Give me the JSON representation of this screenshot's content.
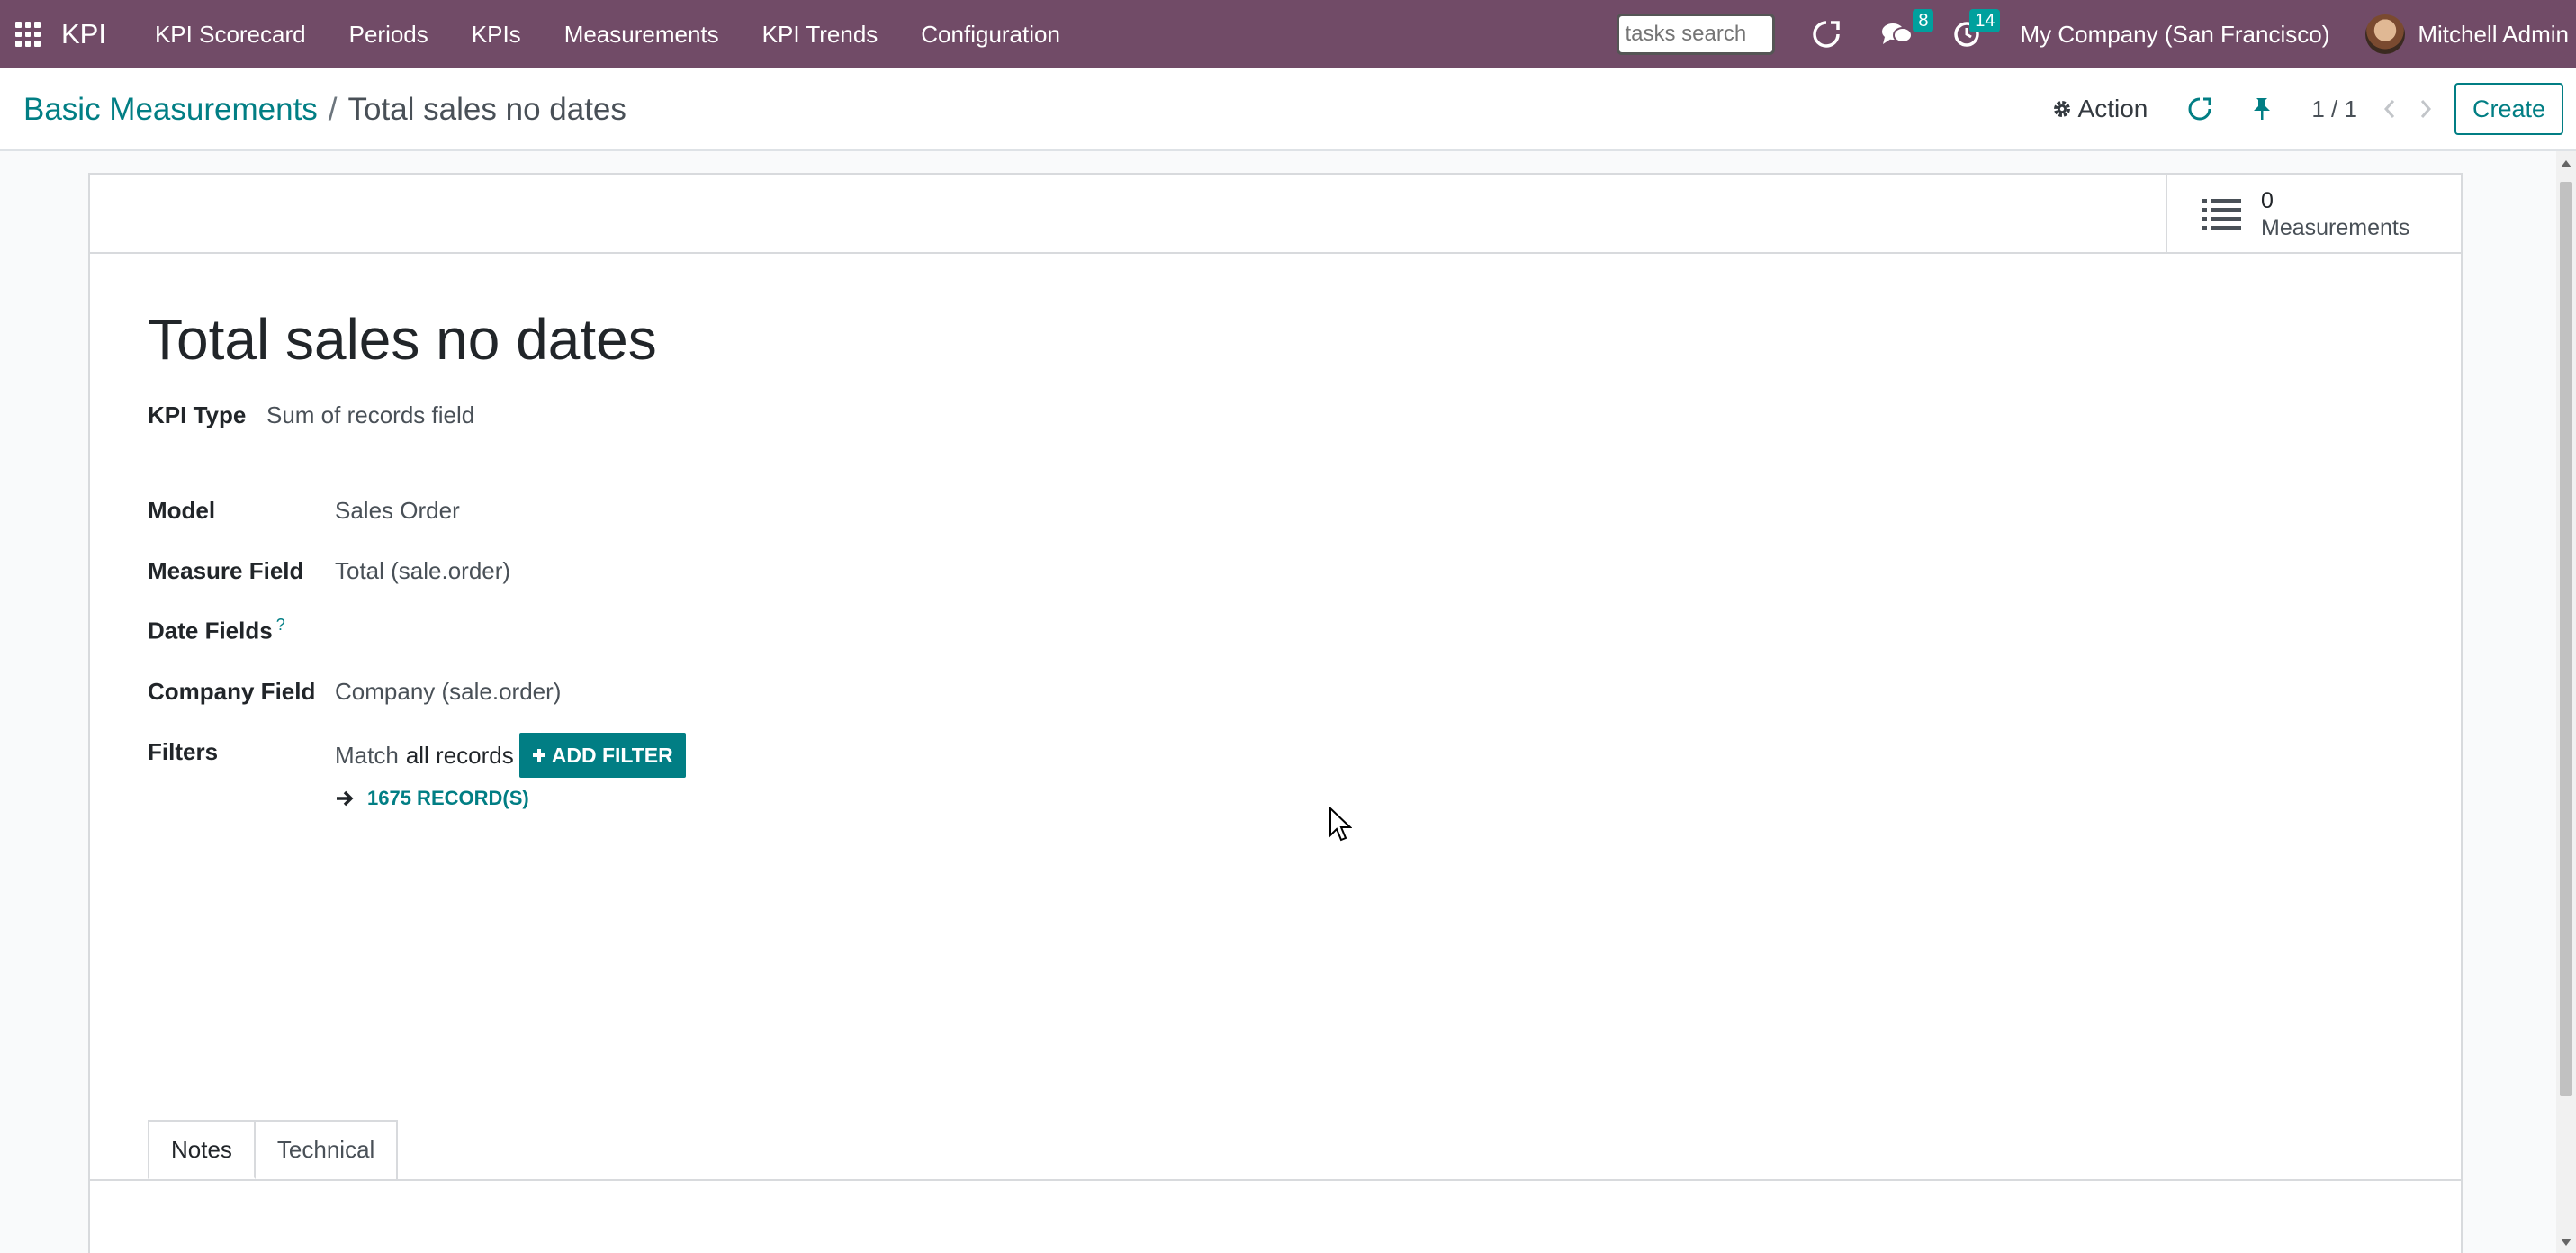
{
  "navbar": {
    "brand": "KPI",
    "menu": [
      "KPI Scorecard",
      "Periods",
      "KPIs",
      "Measurements",
      "KPI Trends",
      "Configuration"
    ],
    "search_placeholder": "tasks search",
    "messages_count": "8",
    "activities_count": "14",
    "company": "My Company (San Francisco)",
    "user": "Mitchell Admin"
  },
  "breadcrumb": {
    "parent": "Basic Measurements",
    "separator": "/",
    "current": "Total sales no dates"
  },
  "control_panel": {
    "action_label": "Action",
    "pager": "1 / 1",
    "create_label": "Create"
  },
  "smart_button": {
    "value": "0",
    "label": "Measurements"
  },
  "form": {
    "title": "Total sales no dates",
    "kpi_type_label": "KPI Type",
    "kpi_type_value": "Sum of records field",
    "model_label": "Model",
    "model_value": "Sales Order",
    "measure_field_label": "Measure Field",
    "measure_field_value": "Total (sale.order)",
    "date_fields_label": "Date Fields",
    "date_fields_help": "?",
    "company_field_label": "Company Field",
    "company_field_value": "Company (sale.order)",
    "filters_label": "Filters",
    "filters_match": "Match",
    "filters_scope": "all records",
    "add_filter_label": "ADD FILTER",
    "records_link": "1675 RECORD(S)"
  },
  "tabs": [
    "Notes",
    "Technical"
  ],
  "colors": {
    "navbar": "#714b67",
    "accent": "#017e84",
    "badge": "#00a09d"
  }
}
